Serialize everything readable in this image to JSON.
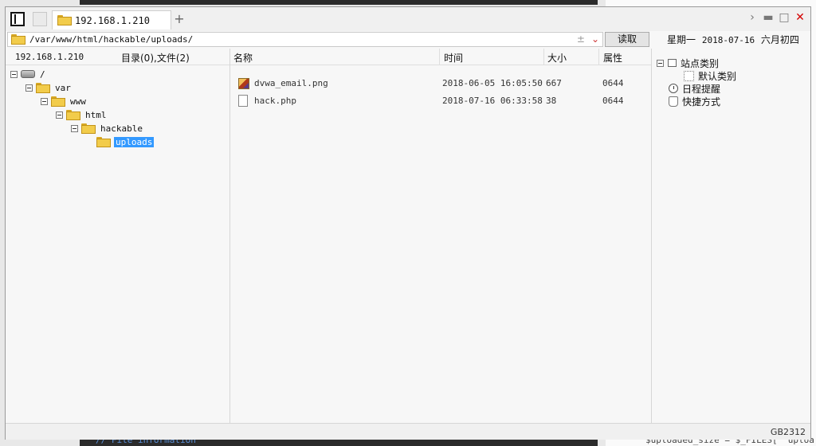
{
  "window": {
    "tab_title": "192.168.1.210",
    "add_tab": "+"
  },
  "address": {
    "path": "/var/www/html/hackable/uploads/",
    "icons": [
      "plus-minus-icon",
      "chevron-down-icon"
    ],
    "read_button": "读取"
  },
  "calendar": {
    "weekday": "星期一",
    "date": "2018-07-16",
    "lunar": "六月初四"
  },
  "left_pane": {
    "host": "192.168.1.210",
    "counts": "目录(0),文件(2)",
    "tree": [
      {
        "label": "/",
        "icon": "drive-icon",
        "selected": false
      },
      {
        "label": "var",
        "icon": "folder-icon",
        "selected": false
      },
      {
        "label": "www",
        "icon": "folder-icon",
        "selected": false
      },
      {
        "label": "html",
        "icon": "folder-icon",
        "selected": false
      },
      {
        "label": "hackable",
        "icon": "folder-icon",
        "selected": false
      },
      {
        "label": "uploads",
        "icon": "folder-open-icon",
        "selected": true
      }
    ]
  },
  "file_list": {
    "columns": {
      "name": "名称",
      "time": "时间",
      "size": "大小",
      "attr": "属性"
    },
    "rows": [
      {
        "name": "dvwa_email.png",
        "time": "2018-06-05 16:05:50",
        "size": "667",
        "attr": "0644",
        "icon": "image-file-icon"
      },
      {
        "name": "hack.php",
        "time": "2018-07-16 06:33:58",
        "size": "38",
        "attr": "0644",
        "icon": "document-file-icon"
      }
    ]
  },
  "right_pane": {
    "items": [
      {
        "label": "站点类别"
      },
      {
        "label": "默认类别"
      },
      {
        "label": "日程提醒"
      },
      {
        "label": "快捷方式"
      }
    ]
  },
  "status": {
    "encoding": "GB2312"
  },
  "background": {
    "bottom_code": "// File information",
    "bottom_right": "$uploaded_size = $_FILES[ 'uploa"
  }
}
